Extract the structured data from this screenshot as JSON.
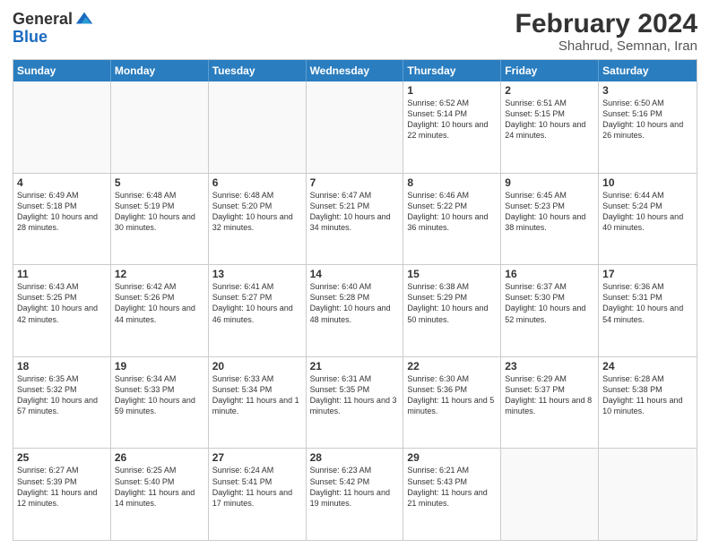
{
  "logo": {
    "general": "General",
    "blue": "Blue"
  },
  "title": "February 2024",
  "subtitle": "Shahrud, Semnan, Iran",
  "header_days": [
    "Sunday",
    "Monday",
    "Tuesday",
    "Wednesday",
    "Thursday",
    "Friday",
    "Saturday"
  ],
  "weeks": [
    [
      {
        "day": "",
        "info": "",
        "empty": true
      },
      {
        "day": "",
        "info": "",
        "empty": true
      },
      {
        "day": "",
        "info": "",
        "empty": true
      },
      {
        "day": "",
        "info": "",
        "empty": true
      },
      {
        "day": "1",
        "info": "Sunrise: 6:52 AM\nSunset: 5:14 PM\nDaylight: 10 hours and 22 minutes."
      },
      {
        "day": "2",
        "info": "Sunrise: 6:51 AM\nSunset: 5:15 PM\nDaylight: 10 hours and 24 minutes."
      },
      {
        "day": "3",
        "info": "Sunrise: 6:50 AM\nSunset: 5:16 PM\nDaylight: 10 hours and 26 minutes."
      }
    ],
    [
      {
        "day": "4",
        "info": "Sunrise: 6:49 AM\nSunset: 5:18 PM\nDaylight: 10 hours and 28 minutes."
      },
      {
        "day": "5",
        "info": "Sunrise: 6:48 AM\nSunset: 5:19 PM\nDaylight: 10 hours and 30 minutes."
      },
      {
        "day": "6",
        "info": "Sunrise: 6:48 AM\nSunset: 5:20 PM\nDaylight: 10 hours and 32 minutes."
      },
      {
        "day": "7",
        "info": "Sunrise: 6:47 AM\nSunset: 5:21 PM\nDaylight: 10 hours and 34 minutes."
      },
      {
        "day": "8",
        "info": "Sunrise: 6:46 AM\nSunset: 5:22 PM\nDaylight: 10 hours and 36 minutes."
      },
      {
        "day": "9",
        "info": "Sunrise: 6:45 AM\nSunset: 5:23 PM\nDaylight: 10 hours and 38 minutes."
      },
      {
        "day": "10",
        "info": "Sunrise: 6:44 AM\nSunset: 5:24 PM\nDaylight: 10 hours and 40 minutes."
      }
    ],
    [
      {
        "day": "11",
        "info": "Sunrise: 6:43 AM\nSunset: 5:25 PM\nDaylight: 10 hours and 42 minutes."
      },
      {
        "day": "12",
        "info": "Sunrise: 6:42 AM\nSunset: 5:26 PM\nDaylight: 10 hours and 44 minutes."
      },
      {
        "day": "13",
        "info": "Sunrise: 6:41 AM\nSunset: 5:27 PM\nDaylight: 10 hours and 46 minutes."
      },
      {
        "day": "14",
        "info": "Sunrise: 6:40 AM\nSunset: 5:28 PM\nDaylight: 10 hours and 48 minutes."
      },
      {
        "day": "15",
        "info": "Sunrise: 6:38 AM\nSunset: 5:29 PM\nDaylight: 10 hours and 50 minutes."
      },
      {
        "day": "16",
        "info": "Sunrise: 6:37 AM\nSunset: 5:30 PM\nDaylight: 10 hours and 52 minutes."
      },
      {
        "day": "17",
        "info": "Sunrise: 6:36 AM\nSunset: 5:31 PM\nDaylight: 10 hours and 54 minutes."
      }
    ],
    [
      {
        "day": "18",
        "info": "Sunrise: 6:35 AM\nSunset: 5:32 PM\nDaylight: 10 hours and 57 minutes."
      },
      {
        "day": "19",
        "info": "Sunrise: 6:34 AM\nSunset: 5:33 PM\nDaylight: 10 hours and 59 minutes."
      },
      {
        "day": "20",
        "info": "Sunrise: 6:33 AM\nSunset: 5:34 PM\nDaylight: 11 hours and 1 minute."
      },
      {
        "day": "21",
        "info": "Sunrise: 6:31 AM\nSunset: 5:35 PM\nDaylight: 11 hours and 3 minutes."
      },
      {
        "day": "22",
        "info": "Sunrise: 6:30 AM\nSunset: 5:36 PM\nDaylight: 11 hours and 5 minutes."
      },
      {
        "day": "23",
        "info": "Sunrise: 6:29 AM\nSunset: 5:37 PM\nDaylight: 11 hours and 8 minutes."
      },
      {
        "day": "24",
        "info": "Sunrise: 6:28 AM\nSunset: 5:38 PM\nDaylight: 11 hours and 10 minutes."
      }
    ],
    [
      {
        "day": "25",
        "info": "Sunrise: 6:27 AM\nSunset: 5:39 PM\nDaylight: 11 hours and 12 minutes."
      },
      {
        "day": "26",
        "info": "Sunrise: 6:25 AM\nSunset: 5:40 PM\nDaylight: 11 hours and 14 minutes."
      },
      {
        "day": "27",
        "info": "Sunrise: 6:24 AM\nSunset: 5:41 PM\nDaylight: 11 hours and 17 minutes."
      },
      {
        "day": "28",
        "info": "Sunrise: 6:23 AM\nSunset: 5:42 PM\nDaylight: 11 hours and 19 minutes."
      },
      {
        "day": "29",
        "info": "Sunrise: 6:21 AM\nSunset: 5:43 PM\nDaylight: 11 hours and 21 minutes."
      },
      {
        "day": "",
        "info": "",
        "empty": true
      },
      {
        "day": "",
        "info": "",
        "empty": true
      }
    ]
  ]
}
